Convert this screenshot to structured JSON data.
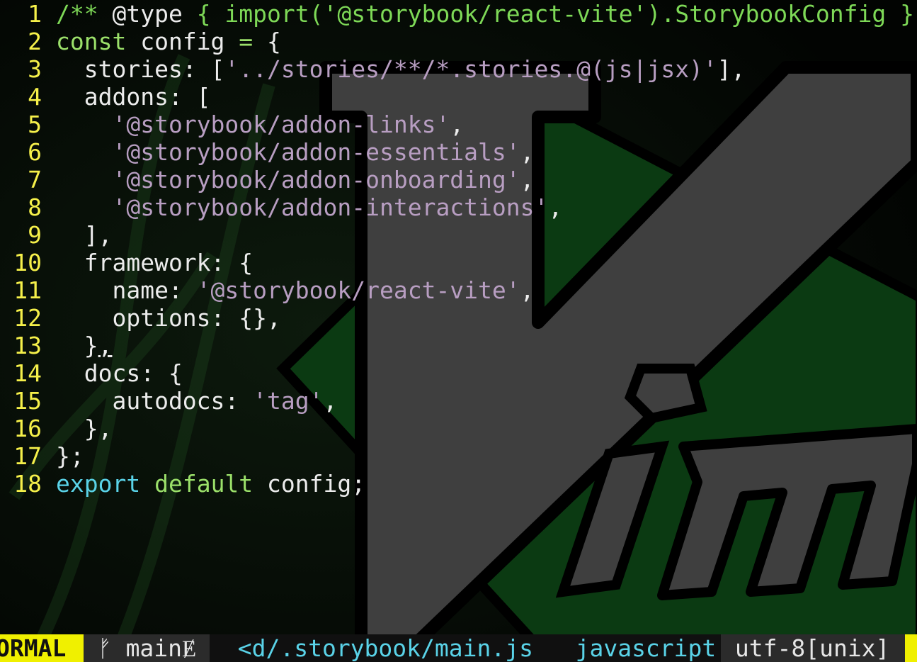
{
  "editor": {
    "lines": [
      {
        "n": "1",
        "tokens": [
          {
            "t": "/** ",
            "c": "c-comment"
          },
          {
            "t": "@type",
            "c": "c-plain"
          },
          {
            "t": " { import('@storybook/react-vite').StorybookConfig }",
            "c": "c-comment"
          }
        ]
      },
      {
        "n": "2",
        "tokens": [
          {
            "t": "const",
            "c": "c-kw"
          },
          {
            "t": " config ",
            "c": "c-plain"
          },
          {
            "t": "=",
            "c": "c-kw"
          },
          {
            "t": " {",
            "c": "c-plain"
          }
        ]
      },
      {
        "n": "3",
        "tokens": [
          {
            "t": "  stories: [",
            "c": "c-plain"
          },
          {
            "t": "'../stories/**/*.stories.@(js|jsx)'",
            "c": "c-str"
          },
          {
            "t": "],",
            "c": "c-plain"
          }
        ]
      },
      {
        "n": "4",
        "tokens": [
          {
            "t": "  addons: [",
            "c": "c-plain"
          }
        ]
      },
      {
        "n": "5",
        "tokens": [
          {
            "t": "    ",
            "c": "c-plain"
          },
          {
            "t": "'@storybook/addon-links'",
            "c": "c-str"
          },
          {
            "t": ",",
            "c": "c-plain"
          }
        ]
      },
      {
        "n": "6",
        "tokens": [
          {
            "t": "    ",
            "c": "c-plain"
          },
          {
            "t": "'@storybook/addon-essentials'",
            "c": "c-str"
          },
          {
            "t": ",",
            "c": "c-plain"
          }
        ]
      },
      {
        "n": "7",
        "tokens": [
          {
            "t": "    ",
            "c": "c-plain"
          },
          {
            "t": "'@storybook/addon-onboarding'",
            "c": "c-str"
          },
          {
            "t": ",",
            "c": "c-plain"
          }
        ]
      },
      {
        "n": "8",
        "tokens": [
          {
            "t": "    ",
            "c": "c-plain"
          },
          {
            "t": "'@storybook/addon-interactions'",
            "c": "c-str"
          },
          {
            "t": ",",
            "c": "c-plain"
          }
        ]
      },
      {
        "n": "9",
        "tokens": [
          {
            "t": "  ],",
            "c": "c-plain"
          }
        ]
      },
      {
        "n": "10",
        "tokens": [
          {
            "t": "  framework: {",
            "c": "c-plain"
          }
        ]
      },
      {
        "n": "11",
        "tokens": [
          {
            "t": "    name: ",
            "c": "c-plain"
          },
          {
            "t": "'@storybook/react-vite'",
            "c": "c-str"
          },
          {
            "t": ",",
            "c": "c-plain"
          }
        ]
      },
      {
        "n": "12",
        "tokens": [
          {
            "t": "    options: {},",
            "c": "c-plain"
          }
        ]
      },
      {
        "n": "13",
        "tokens": [
          {
            "t": "  }",
            "c": "c-plain"
          },
          {
            "t": ",",
            "c": "c-plain u"
          }
        ]
      },
      {
        "n": "14",
        "tokens": [
          {
            "t": "  docs: {",
            "c": "c-plain"
          }
        ]
      },
      {
        "n": "15",
        "tokens": [
          {
            "t": "    autodocs: ",
            "c": "c-plain"
          },
          {
            "t": "'tag'",
            "c": "c-str"
          },
          {
            "t": ",",
            "c": "c-plain"
          }
        ]
      },
      {
        "n": "16",
        "tokens": [
          {
            "t": "  },",
            "c": "c-plain"
          }
        ]
      },
      {
        "n": "17",
        "tokens": [
          {
            "t": "};",
            "c": "c-plain"
          }
        ]
      },
      {
        "n": "18",
        "tokens": [
          {
            "t": "export",
            "c": "c-blue"
          },
          {
            "t": " ",
            "c": "c-plain"
          },
          {
            "t": "default",
            "c": "c-kw"
          },
          {
            "t": " config;",
            "c": "c-plain"
          }
        ]
      }
    ]
  },
  "statusline": {
    "mode": "ORMAL",
    "branch_icon": "ᚠ",
    "branch": "main",
    "branch_modified": "Ɇ",
    "file": "<d/.storybook/main.js",
    "filetype": "javascript",
    "encoding": "utf-8[unix]"
  },
  "colors": {
    "line_number": "#f5f04a",
    "mode_bg": "#f0f000",
    "string": "#b89ec2",
    "keyword": "#9be06a",
    "filename": "#5ad3e8"
  },
  "background": {
    "logo": "vim-logo"
  }
}
